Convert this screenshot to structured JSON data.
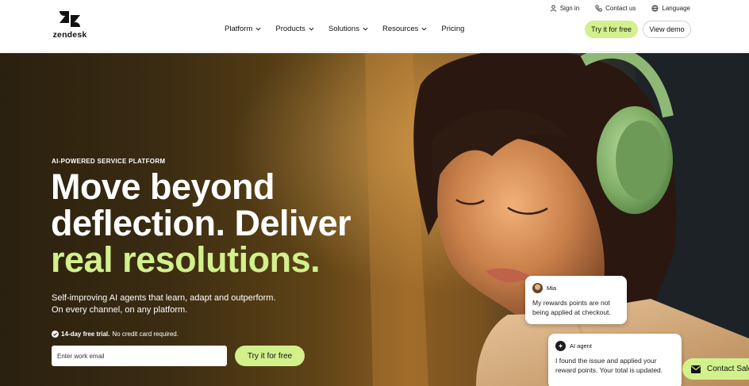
{
  "brand": {
    "name": "zendesk",
    "accent": "#d2f08c"
  },
  "utility_nav": [
    {
      "label": "Sign in",
      "icon": "user-icon"
    },
    {
      "label": "Contact us",
      "icon": "phone-icon"
    },
    {
      "label": "Language",
      "icon": "globe-icon"
    }
  ],
  "main_nav": [
    {
      "label": "Platform",
      "has_dropdown": true
    },
    {
      "label": "Products",
      "has_dropdown": true
    },
    {
      "label": "Solutions",
      "has_dropdown": true
    },
    {
      "label": "Resources",
      "has_dropdown": true
    },
    {
      "label": "Pricing",
      "has_dropdown": false
    }
  ],
  "header_buttons": {
    "try_free": "Try it for free",
    "view_demo": "View demo"
  },
  "hero": {
    "eyebrow": "AI-POWERED SERVICE PLATFORM",
    "headline_line1": "Move beyond",
    "headline_line2": "deflection. Deliver",
    "headline_line3": "real resolutions.",
    "subtext_line1": "Self-improving AI agents that learn, adapt and outperform.",
    "subtext_line2": "On every channel, on any platform.",
    "trial_bold": "14-day free trial.",
    "trial_rest": "No credit card required.",
    "email_placeholder": "Enter work email",
    "cta": "Try it for free"
  },
  "chat": {
    "customer_name": "Mia",
    "customer_msg_line1": "My rewards points are not",
    "customer_msg_line2": "being applied at checkout.",
    "agent_name": "AI agent",
    "agent_msg_line1": "I found the issue and applied your",
    "agent_msg_line2": "reward points. Your total is updated."
  },
  "contact_sales": "Contact Sales"
}
